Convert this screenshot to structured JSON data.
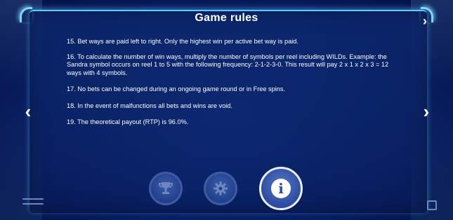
{
  "dialog": {
    "title": "Game rules"
  },
  "rules": [
    "15. Bet ways are paid left to right. Only the highest win per active bet way is paid.",
    "16. To calculate the number of win ways, multiply the number of symbols per reel including WILDs. Example: the Sandra symbol occurs on reel 1 to 5 with the following frequency:  2-1-2-3-0. This result will pay 2 x 1 x 2 x 3 = 12 ways with 4 symbols.",
    "17. No bets can be changed during an ongoing game round or in Free spins.",
    "18. In the event of malfunctions all bets and wins are void.",
    "19. The theoretical payout (RTP) is 96.0%."
  ],
  "navigation": {
    "prev_icon": "chevron-left-icon",
    "next_icon": "chevron-right-icon",
    "prev_glyph": "‹",
    "next_glyph": "›"
  },
  "buttons": {
    "paytable_icon": "trophy-icon",
    "settings_icon": "gear-icon",
    "info_icon": "info-icon"
  },
  "colors": {
    "accent": "#5fc9ff",
    "background": "#0c2a78",
    "text": "#ffffff"
  }
}
